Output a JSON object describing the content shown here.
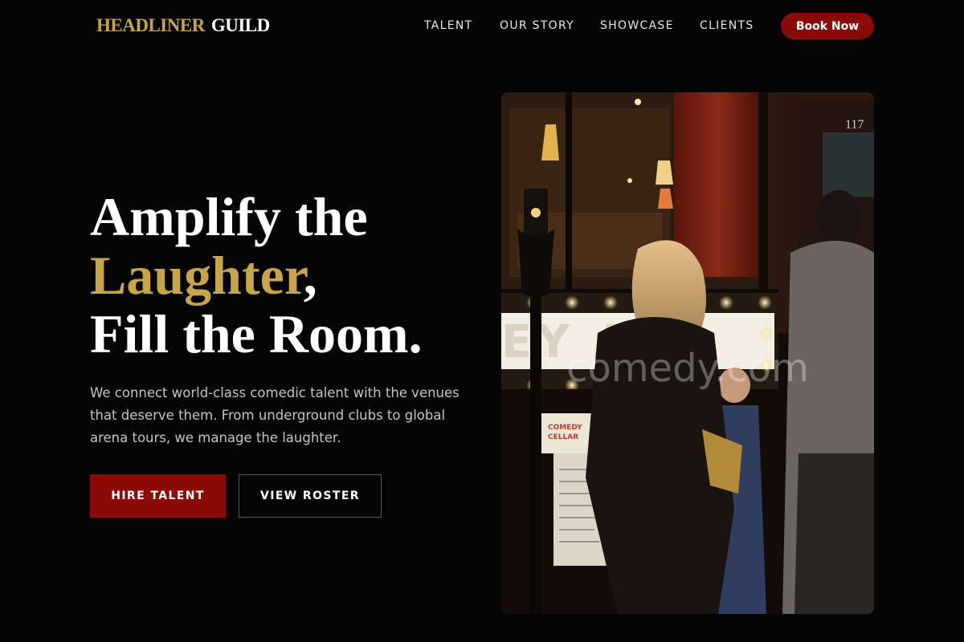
{
  "brand": {
    "part1": "HEADLINER",
    "part2": "GUILD"
  },
  "nav": {
    "items": [
      {
        "label": "TALENT"
      },
      {
        "label": "OUR STORY"
      },
      {
        "label": "SHOWCASE"
      },
      {
        "label": "CLIENTS"
      }
    ],
    "cta_label": "Book Now"
  },
  "hero": {
    "line1": "Amplify the",
    "line2_accent": "Laughter",
    "line2_rest": ",",
    "line3": "Fill the Room.",
    "description": "We connect world-class comedic talent with the venues that deserve them. From underground clubs to global arena tours, we manage the laughter.",
    "primary_button": "HIRE TALENT",
    "secondary_button": "VIEW ROSTER"
  },
  "image": {
    "watermark": "comedy.com",
    "marquee_text": "EY   AR",
    "door_number": "117",
    "sign_text": "COMEDY CELLAR"
  },
  "colors": {
    "accent_gold": "#c9a54a",
    "accent_red": "#8b0a0a",
    "background": "#040404"
  }
}
